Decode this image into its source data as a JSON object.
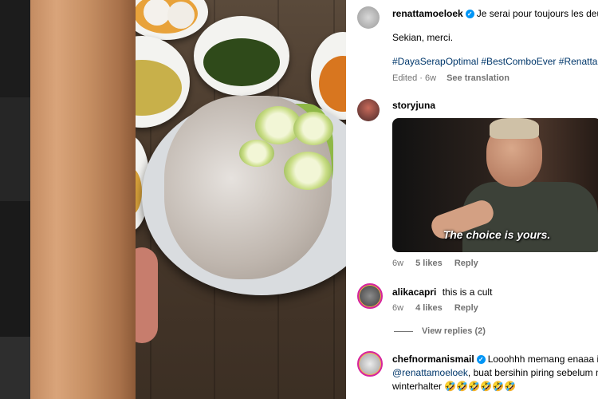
{
  "comments": [
    {
      "username": "renattamoeloek",
      "verified": true,
      "text": "Je serai pour toujours les deux",
      "line2": "Sekian, merci.",
      "hashtags": "#DayaSerapOptimal #BestComboEver #RenattaSc",
      "meta": {
        "edited": "Edited · 6w",
        "translate": "See translation"
      }
    },
    {
      "username": "storyjuna",
      "gif_caption": "The choice is yours.",
      "meta": {
        "age": "6w",
        "likes": "5 likes",
        "reply": "Reply"
      }
    },
    {
      "username": "alikacapri",
      "text": "this is a cult",
      "meta": {
        "age": "6w",
        "likes": "4 likes",
        "reply": "Reply"
      },
      "view_replies": "View replies (2)"
    },
    {
      "username": "chefnormanismail",
      "verified": true,
      "text": "Looohhh memang enaaa ini",
      "mention": "@renattamoeloek",
      "text2": ", buat bersihin piring sebelum m",
      "text3": "winterhalter 🤣🤣🤣🤣🤣🤣"
    }
  ]
}
